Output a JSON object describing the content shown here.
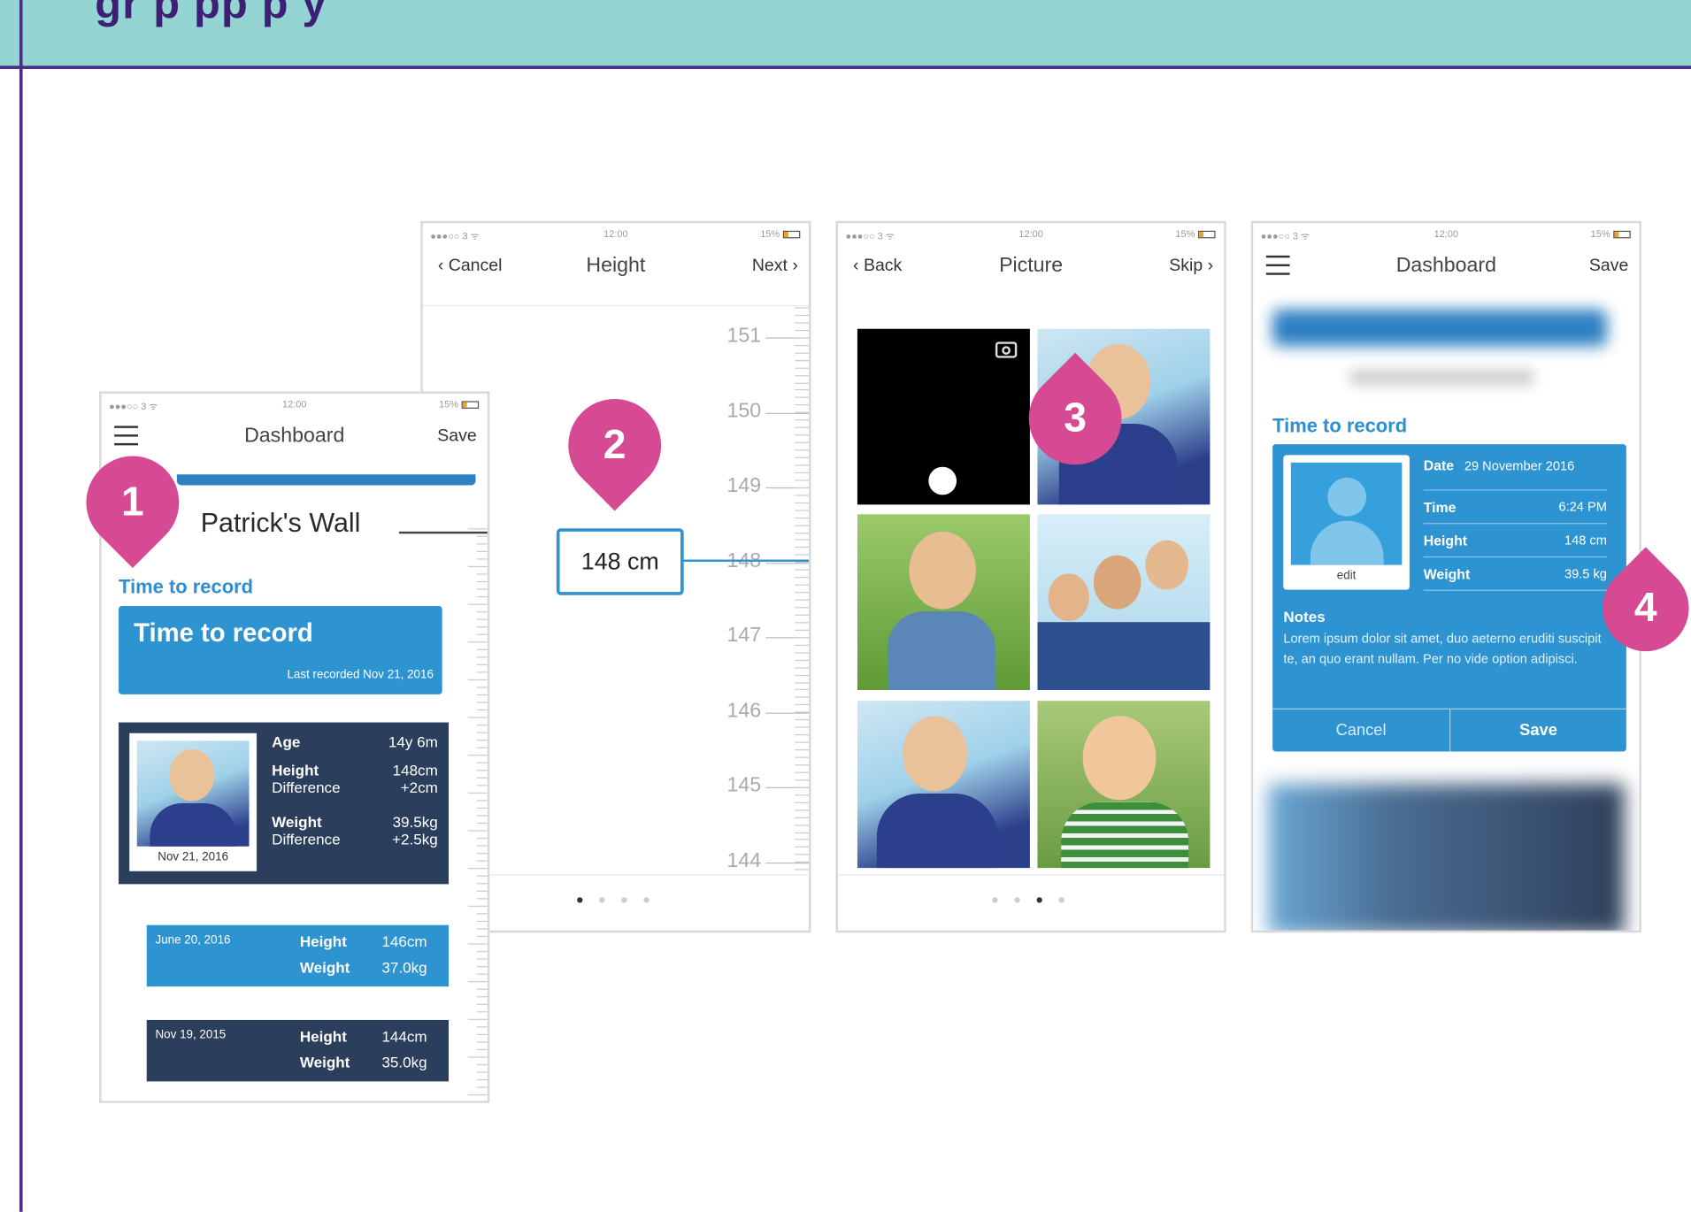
{
  "banner": {
    "title": "gr   p   pp   p   y"
  },
  "status": {
    "carrier": "●●●○○ 3 ᯤ",
    "time": "12:00",
    "battery": "15%"
  },
  "pins": [
    "1",
    "2",
    "3",
    "4"
  ],
  "screen1": {
    "nav": {
      "title": "Dashboard",
      "right": "Save"
    },
    "wall_title": "Patrick's Wall",
    "section_label": "Time to record",
    "banner_title": "Time to record",
    "banner_sub": "Last recorded Nov 21, 2016",
    "card": {
      "photo_date": "Nov 21, 2016",
      "age_label": "Age",
      "age_value": "14y 6m",
      "height_label": "Height",
      "height_value": "148cm",
      "height_diff_label": "Difference",
      "height_diff_value": "+2cm",
      "weight_label": "Weight",
      "weight_value": "39.5kg",
      "weight_diff_label": "Difference",
      "weight_diff_value": "+2.5kg"
    },
    "entries": [
      {
        "date": "June 20, 2016",
        "height_label": "Height",
        "height": "146cm",
        "weight_label": "Weight",
        "weight": "37.0kg"
      },
      {
        "date": "Nov 19, 2015",
        "height_label": "Height",
        "height": "144cm",
        "weight_label": "Weight",
        "weight": "35.0kg"
      }
    ]
  },
  "screen2": {
    "nav": {
      "left": "Cancel",
      "title": "Height",
      "right": "Next"
    },
    "ruler": [
      "151",
      "150",
      "149",
      "148",
      "147",
      "146",
      "145",
      "144"
    ],
    "value": "148 cm",
    "page_dots": "● ● ● ●"
  },
  "screen3": {
    "nav": {
      "left": "Back",
      "title": "Picture",
      "right": "Skip"
    },
    "page_dots": "● ● ● ●"
  },
  "screen4": {
    "nav": {
      "title": "Dashboard",
      "right": "Save"
    },
    "section_label": "Time to record",
    "edit_label": "edit",
    "date_label": "Date",
    "date_value": "29 November 2016",
    "time_label": "Time",
    "time_value": "6:24 PM",
    "height_label": "Height",
    "height_value": "148 cm",
    "weight_label": "Weight",
    "weight_value": "39.5 kg",
    "notes_label": "Notes",
    "notes_text": "Lorem ipsum dolor sit amet, duo aeterno eruditi suscipit te, an quo erant nullam. Per no vide option adipisci.",
    "cancel_label": "Cancel",
    "save_label": "Save"
  }
}
